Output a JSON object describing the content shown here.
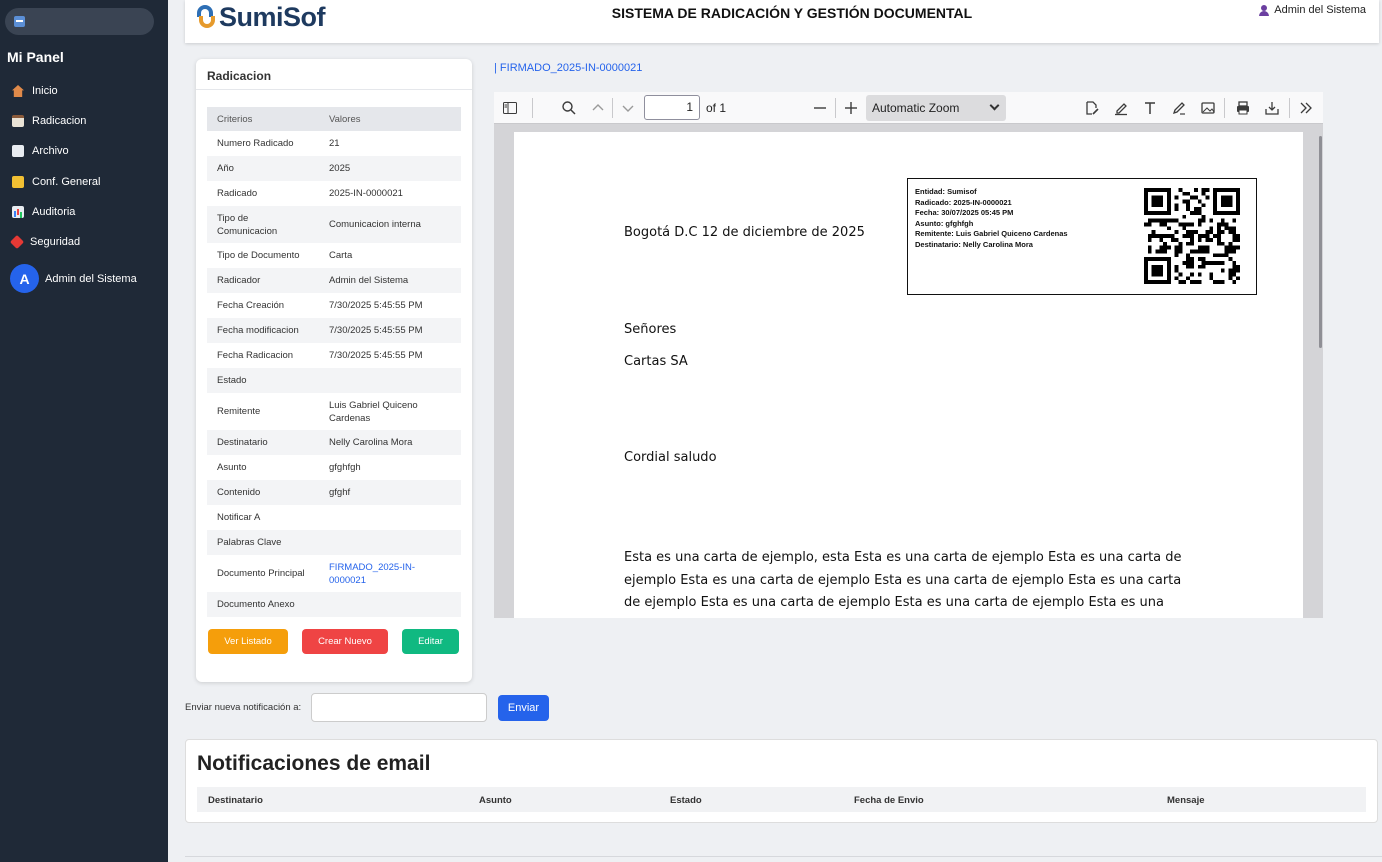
{
  "sidebar": {
    "panel_title": "Mi Panel",
    "items": [
      {
        "label": "Inicio",
        "icon": "home-icon"
      },
      {
        "label": "Radicacion",
        "icon": "clipboard-icon"
      },
      {
        "label": "Archivo",
        "icon": "document-icon"
      },
      {
        "label": "Conf. General",
        "icon": "folder-icon"
      },
      {
        "label": "Auditoria",
        "icon": "chart-icon"
      },
      {
        "label": "Seguridad",
        "icon": "pin-icon"
      }
    ],
    "user": {
      "initial": "A",
      "name": "Admin del Sistema"
    }
  },
  "header": {
    "logo_text": "SumiSof",
    "title": "SISTEMA DE RADICACIÓN Y GESTIÓN DOCUMENTAL",
    "user": "Admin del Sistema"
  },
  "radicacion": {
    "title": "Radicacion",
    "columns": [
      "Criterios",
      "Valores"
    ],
    "rows": [
      {
        "label": "Numero Radicado",
        "value": "21"
      },
      {
        "label": "Año",
        "value": "2025"
      },
      {
        "label": "Radicado",
        "value": "2025-IN-0000021"
      },
      {
        "label": "Tipo de Comunicacion",
        "value": "Comunicacion interna"
      },
      {
        "label": "Tipo de Documento",
        "value": "Carta"
      },
      {
        "label": "Radicador",
        "value": "Admin del Sistema"
      },
      {
        "label": "Fecha Creación",
        "value": "7/30/2025 5:45:55 PM"
      },
      {
        "label": "Fecha modificacion",
        "value": "7/30/2025 5:45:55 PM"
      },
      {
        "label": "Fecha Radicacion",
        "value": "7/30/2025 5:45:55 PM"
      },
      {
        "label": "Estado",
        "value": ""
      },
      {
        "label": "Remitente",
        "value": "Luis Gabriel Quiceno Cardenas"
      },
      {
        "label": "Destinatario",
        "value": "Nelly Carolina Mora"
      },
      {
        "label": "Asunto",
        "value": "gfghfgh"
      },
      {
        "label": "Contenido",
        "value": "gfghf"
      },
      {
        "label": "Notificar A",
        "value": ""
      },
      {
        "label": "Palabras Clave",
        "value": ""
      },
      {
        "label": "Documento Principal",
        "value": "FIRMADO_2025-IN-0000021"
      },
      {
        "label": "Documento Anexo",
        "value": ""
      }
    ],
    "buttons": {
      "list": "Ver Listado",
      "new": "Crear Nuevo",
      "edit": "Editar"
    }
  },
  "viewer": {
    "doc_link": "| FIRMADO_2025-IN-0000021",
    "page_number": "1",
    "page_total": "of 1",
    "zoom": "Automatic Zoom",
    "letter": {
      "date_line": "Bogotá D.C  12 de diciembre de 2025",
      "salutation": "Señores",
      "company": "Cartas SA",
      "greeting": "Cordial saludo",
      "body": "Esta es una carta de ejemplo, esta Esta es una carta de ejemplo Esta es una carta de ejemplo Esta es una carta de ejemplo Esta es una carta de ejemplo Esta es una carta de ejemplo Esta es una carta de ejemplo Esta es una carta de ejemplo Esta es una carta de ejemplo Esta es una carta de ejemplo Esta es una carta de ejemplo Esta"
    },
    "stamp": {
      "lines": [
        "Entidad: Sumisof",
        "Radicado: 2025-IN-0000021",
        "Fecha: 30/07/2025 05:45 PM",
        "Asunto: gfghfgh",
        "Remitente: Luis Gabriel Quiceno Cardenas",
        "Destinatario: Nelly Carolina Mora"
      ]
    }
  },
  "notification": {
    "label": "Enviar nueva notificación a:",
    "input_value": "",
    "send_label": "Enviar"
  },
  "email": {
    "title": "Notificaciones de email",
    "columns": [
      "Destinatario",
      "Asunto",
      "Estado",
      "Fecha de Envio",
      "Mensaje"
    ]
  },
  "colors": {
    "sidebar_bg": "#1f2937",
    "primary": "#2563eb",
    "warning": "#f59e0b",
    "danger": "#ef4444",
    "success": "#10b981"
  }
}
